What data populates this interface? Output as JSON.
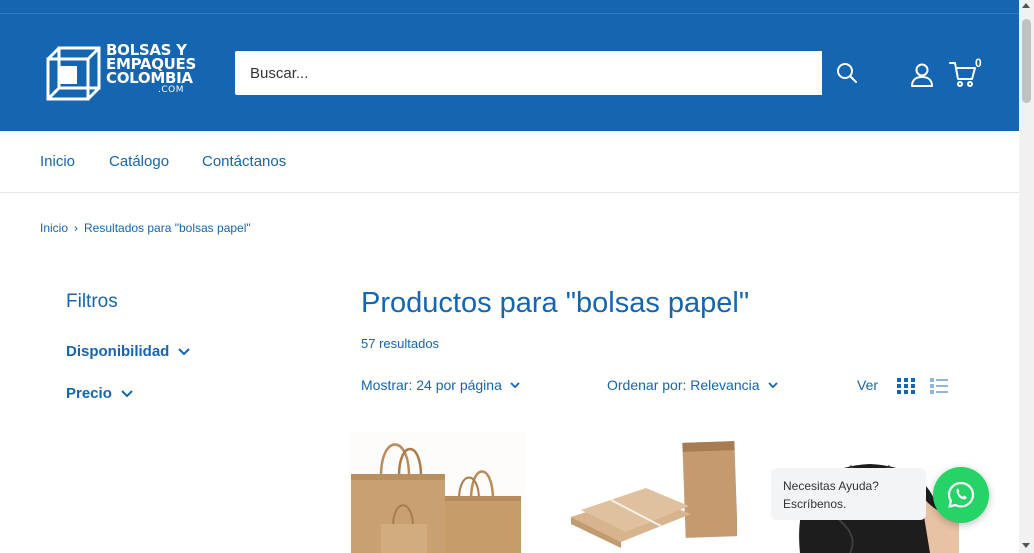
{
  "header": {
    "logo_line1": "BOLSAS Y",
    "logo_line2": "EMPAQUES",
    "logo_line3": "COLOMBIA",
    "logo_line4": ".COM",
    "search_placeholder": "Buscar...",
    "cart_count": "0",
    "brand_color": "#1565b0"
  },
  "nav": {
    "items": [
      {
        "label": "Inicio"
      },
      {
        "label": "Catálogo"
      },
      {
        "label": "Contáctanos"
      }
    ]
  },
  "breadcrumb": {
    "home": "Inicio",
    "separator": "›",
    "current": "Resultados para \"bolsas papel\""
  },
  "filters": {
    "title": "Filtros",
    "facets": [
      {
        "label": "Disponibilidad"
      },
      {
        "label": "Precio"
      }
    ]
  },
  "results": {
    "title": "Productos para \"bolsas papel\"",
    "count": "57 resultados",
    "show_label": "Mostrar: 24 por página",
    "sort_label": "Ordenar por: Relevancia",
    "view_label": "Ver"
  },
  "products": [
    {
      "image": "kraft-bags-with-handles"
    },
    {
      "image": "kraft-paper-sachets"
    },
    {
      "image": "black-bag-held-by-hand"
    }
  ],
  "whatsapp": {
    "line1": "Necesitas Ayuda?",
    "line2": "Escríbenos.",
    "color": "#25d366"
  }
}
